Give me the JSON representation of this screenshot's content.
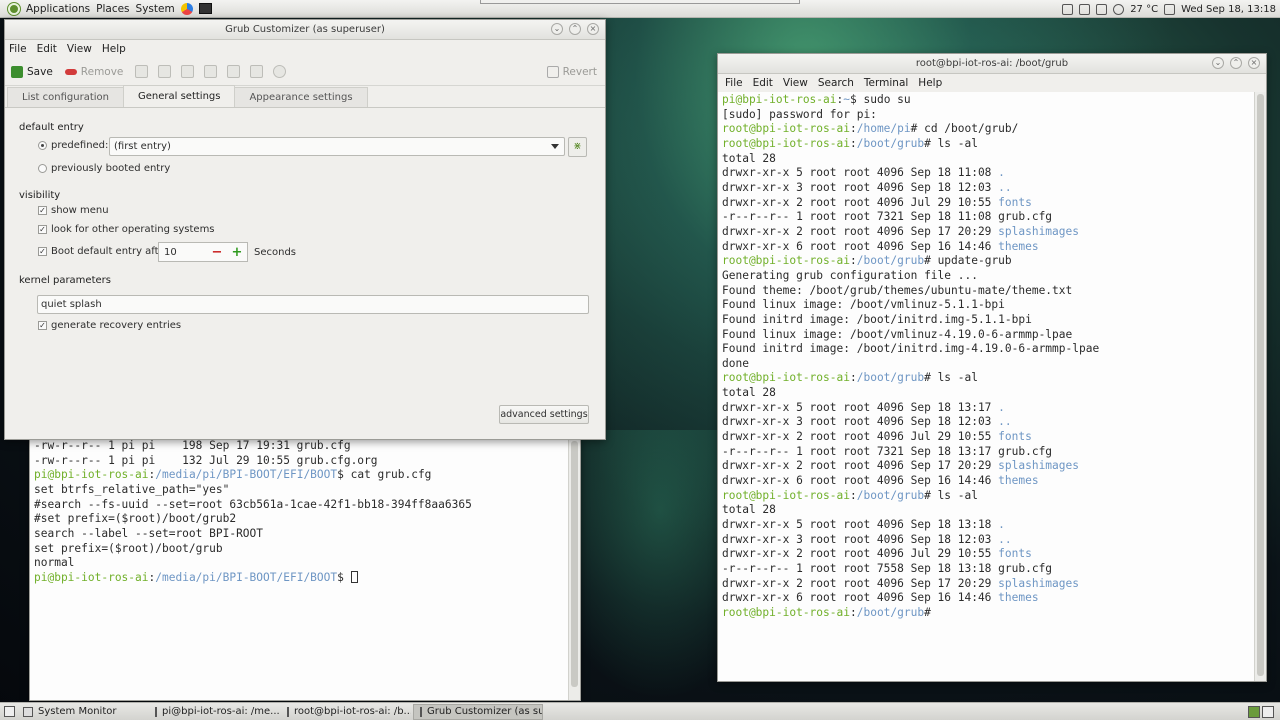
{
  "top_panel": {
    "menus": [
      "Applications",
      "Places",
      "System"
    ],
    "temperature": "27 °C",
    "clock": "Wed Sep 18, 13:18"
  },
  "grub": {
    "title": "Grub Customizer (as superuser)",
    "menu": [
      "File",
      "Edit",
      "View",
      "Help"
    ],
    "toolbar": {
      "save": "Save",
      "remove": "Remove",
      "revert": "Revert"
    },
    "tabs": [
      "List configuration",
      "General settings",
      "Appearance settings"
    ],
    "default_entry": {
      "heading": "default entry",
      "predefined_label": "predefined:",
      "predefined_value": "(first entry)",
      "previously_booted": "previously booted entry"
    },
    "visibility": {
      "heading": "visibility",
      "show_menu": "show menu",
      "look_other_os": "look for other operating systems",
      "boot_default_after": "Boot default entry after",
      "timeout": "10",
      "seconds": "Seconds"
    },
    "kernel": {
      "heading": "kernel parameters",
      "params": "quiet splash",
      "recovery": "generate recovery entries"
    },
    "advanced_button": "advanced settings"
  },
  "term_left": {
    "lines": [
      {
        "parts": [
          {
            "t": "-rw-r--r-- 1 pi pi    198 Sep 17 19:31 grub.cfg"
          }
        ]
      },
      {
        "parts": [
          {
            "t": "-rw-r--r-- 1 pi pi    132 Jul 29 10:55 grub.cfg.org"
          }
        ]
      },
      {
        "parts": [
          {
            "c": "g",
            "t": "pi@bpi-iot-ros-ai"
          },
          {
            "t": ":"
          },
          {
            "c": "b",
            "t": "/media/pi/BPI-BOOT/EFI/BOOT"
          },
          {
            "t": "$ cat grub.cfg"
          }
        ]
      },
      {
        "parts": [
          {
            "t": "set btrfs_relative_path=\"yes\""
          }
        ]
      },
      {
        "parts": [
          {
            "t": "#search --fs-uuid --set=root 63cb561a-1cae-42f1-bb18-394ff8aa6365"
          }
        ]
      },
      {
        "parts": [
          {
            "t": "#set prefix=($root)/boot/grub2"
          }
        ]
      },
      {
        "parts": [
          {
            "t": "search --label --set=root BPI-ROOT"
          }
        ]
      },
      {
        "parts": [
          {
            "t": "set prefix=($root)/boot/grub"
          }
        ]
      },
      {
        "parts": [
          {
            "t": "normal"
          }
        ]
      },
      {
        "parts": [
          {
            "c": "g",
            "t": "pi@bpi-iot-ros-ai"
          },
          {
            "t": ":"
          },
          {
            "c": "b",
            "t": "/media/pi/BPI-BOOT/EFI/BOOT"
          },
          {
            "t": "$ "
          }
        ],
        "cursor": true
      }
    ]
  },
  "term_right": {
    "title": "root@bpi-iot-ros-ai: /boot/grub",
    "menu": [
      "File",
      "Edit",
      "View",
      "Search",
      "Terminal",
      "Help"
    ],
    "lines": [
      {
        "parts": [
          {
            "c": "g",
            "t": "pi@bpi-iot-ros-ai"
          },
          {
            "t": ":"
          },
          {
            "c": "b",
            "t": "~"
          },
          {
            "t": "$ sudo su"
          }
        ]
      },
      {
        "parts": [
          {
            "t": "[sudo] password for pi:"
          }
        ]
      },
      {
        "parts": [
          {
            "c": "g",
            "t": "root@bpi-iot-ros-ai"
          },
          {
            "t": ":"
          },
          {
            "c": "b",
            "t": "/home/pi"
          },
          {
            "t": "# cd /boot/grub/"
          }
        ]
      },
      {
        "parts": [
          {
            "c": "g",
            "t": "root@bpi-iot-ros-ai"
          },
          {
            "t": ":"
          },
          {
            "c": "b",
            "t": "/boot/grub"
          },
          {
            "t": "# ls -al"
          }
        ]
      },
      {
        "parts": [
          {
            "t": "total 28"
          }
        ]
      },
      {
        "parts": [
          {
            "t": "drwxr-xr-x 5 root root 4096 Sep 18 11:08 "
          },
          {
            "c": "b",
            "t": "."
          }
        ]
      },
      {
        "parts": [
          {
            "t": "drwxr-xr-x 3 root root 4096 Sep 18 12:03 "
          },
          {
            "c": "b",
            "t": ".."
          }
        ]
      },
      {
        "parts": [
          {
            "t": "drwxr-xr-x 2 root root 4096 Jul 29 10:55 "
          },
          {
            "c": "b",
            "t": "fonts"
          }
        ]
      },
      {
        "parts": [
          {
            "t": "-r--r--r-- 1 root root 7321 Sep 18 11:08 grub.cfg"
          }
        ]
      },
      {
        "parts": [
          {
            "t": "drwxr-xr-x 2 root root 4096 Sep 17 20:29 "
          },
          {
            "c": "b",
            "t": "splashimages"
          }
        ]
      },
      {
        "parts": [
          {
            "t": "drwxr-xr-x 6 root root 4096 Sep 16 14:46 "
          },
          {
            "c": "b",
            "t": "themes"
          }
        ]
      },
      {
        "parts": [
          {
            "c": "g",
            "t": "root@bpi-iot-ros-ai"
          },
          {
            "t": ":"
          },
          {
            "c": "b",
            "t": "/boot/grub"
          },
          {
            "t": "# update-grub"
          }
        ]
      },
      {
        "parts": [
          {
            "t": "Generating grub configuration file ..."
          }
        ]
      },
      {
        "parts": [
          {
            "t": "Found theme: /boot/grub/themes/ubuntu-mate/theme.txt"
          }
        ]
      },
      {
        "parts": [
          {
            "t": "Found linux image: /boot/vmlinuz-5.1.1-bpi"
          }
        ]
      },
      {
        "parts": [
          {
            "t": "Found initrd image: /boot/initrd.img-5.1.1-bpi"
          }
        ]
      },
      {
        "parts": [
          {
            "t": "Found linux image: /boot/vmlinuz-4.19.0-6-armmp-lpae"
          }
        ]
      },
      {
        "parts": [
          {
            "t": "Found initrd image: /boot/initrd.img-4.19.0-6-armmp-lpae"
          }
        ]
      },
      {
        "parts": [
          {
            "t": "done"
          }
        ]
      },
      {
        "parts": [
          {
            "c": "g",
            "t": "root@bpi-iot-ros-ai"
          },
          {
            "t": ":"
          },
          {
            "c": "b",
            "t": "/boot/grub"
          },
          {
            "t": "# ls -al"
          }
        ]
      },
      {
        "parts": [
          {
            "t": "total 28"
          }
        ]
      },
      {
        "parts": [
          {
            "t": "drwxr-xr-x 5 root root 4096 Sep 18 13:17 "
          },
          {
            "c": "b",
            "t": "."
          }
        ]
      },
      {
        "parts": [
          {
            "t": "drwxr-xr-x 3 root root 4096 Sep 18 12:03 "
          },
          {
            "c": "b",
            "t": ".."
          }
        ]
      },
      {
        "parts": [
          {
            "t": "drwxr-xr-x 2 root root 4096 Jul 29 10:55 "
          },
          {
            "c": "b",
            "t": "fonts"
          }
        ]
      },
      {
        "parts": [
          {
            "t": "-r--r--r-- 1 root root 7321 Sep 18 13:17 grub.cfg"
          }
        ]
      },
      {
        "parts": [
          {
            "t": "drwxr-xr-x 2 root root 4096 Sep 17 20:29 "
          },
          {
            "c": "b",
            "t": "splashimages"
          }
        ]
      },
      {
        "parts": [
          {
            "t": "drwxr-xr-x 6 root root 4096 Sep 16 14:46 "
          },
          {
            "c": "b",
            "t": "themes"
          }
        ]
      },
      {
        "parts": [
          {
            "c": "g",
            "t": "root@bpi-iot-ros-ai"
          },
          {
            "t": ":"
          },
          {
            "c": "b",
            "t": "/boot/grub"
          },
          {
            "t": "# ls -al"
          }
        ]
      },
      {
        "parts": [
          {
            "t": "total 28"
          }
        ]
      },
      {
        "parts": [
          {
            "t": "drwxr-xr-x 5 root root 4096 Sep 18 13:18 "
          },
          {
            "c": "b",
            "t": "."
          }
        ]
      },
      {
        "parts": [
          {
            "t": "drwxr-xr-x 3 root root 4096 Sep 18 12:03 "
          },
          {
            "c": "b",
            "t": ".."
          }
        ]
      },
      {
        "parts": [
          {
            "t": "drwxr-xr-x 2 root root 4096 Jul 29 10:55 "
          },
          {
            "c": "b",
            "t": "fonts"
          }
        ]
      },
      {
        "parts": [
          {
            "t": "-r--r--r-- 1 root root 7558 Sep 18 13:18 grub.cfg"
          }
        ]
      },
      {
        "parts": [
          {
            "t": "drwxr-xr-x 2 root root 4096 Sep 17 20:29 "
          },
          {
            "c": "b",
            "t": "splashimages"
          }
        ]
      },
      {
        "parts": [
          {
            "t": "drwxr-xr-x 6 root root 4096 Sep 16 14:46 "
          },
          {
            "c": "b",
            "t": "themes"
          }
        ]
      },
      {
        "parts": [
          {
            "c": "g",
            "t": "root@bpi-iot-ros-ai"
          },
          {
            "t": ":"
          },
          {
            "c": "b",
            "t": "/boot/grub"
          },
          {
            "t": "# "
          }
        ]
      }
    ]
  },
  "taskbar": {
    "items": [
      "System Monitor",
      "pi@bpi-iot-ros-ai: /me...",
      "root@bpi-iot-ros-ai: /b...",
      "Grub Customizer (as su..."
    ]
  },
  "colors": {
    "prompt_user": "#71b02a",
    "prompt_path": "#6e96c4",
    "remove_icon": "#d23b3b",
    "add_icon": "#2f9a1e"
  }
}
